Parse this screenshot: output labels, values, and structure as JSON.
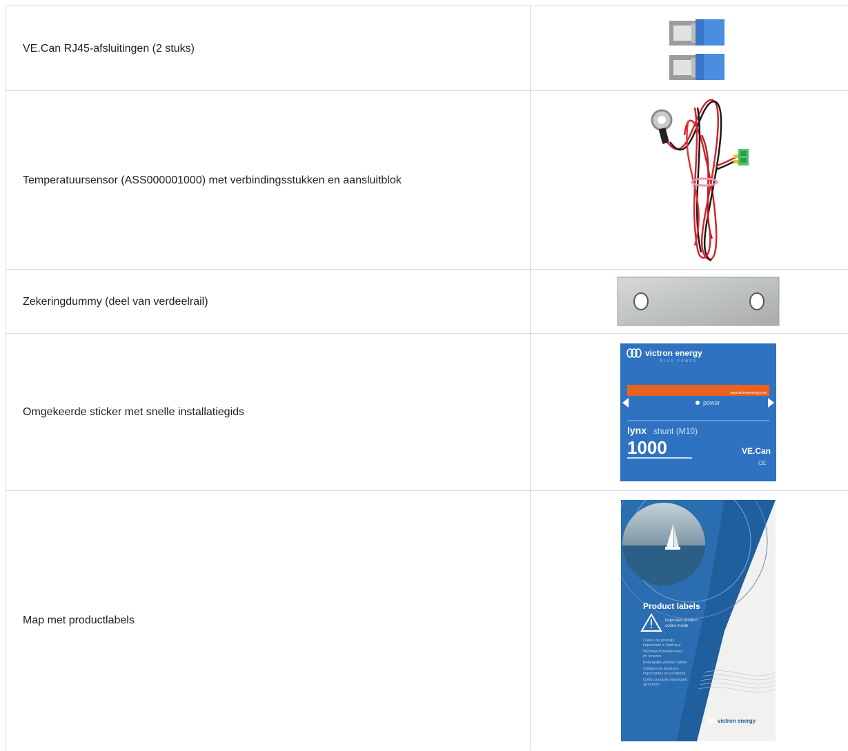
{
  "items": [
    {
      "description": "VE.Can RJ45-afsluitingen (2 stuks)",
      "image": "rj45-terminators-icon"
    },
    {
      "description": "Temperatuursensor (ASS000001000) met verbindingsstukken en aansluitblok",
      "image": "temperature-sensor-cable-icon"
    },
    {
      "description": "Zekeringdummy (deel van verdeelrail)",
      "image": "fuse-dummy-icon"
    },
    {
      "description": "Omgekeerde sticker met snelle installatiegids",
      "image": "sticker-icon"
    },
    {
      "description": "Map met productlabels",
      "image": "product-labels-folder-icon"
    }
  ],
  "sticker": {
    "brand": "victron energy",
    "tagline": "BLUE POWER",
    "url": "www.victronenergy.com",
    "power": "power",
    "product_bold": "lynx",
    "product_rest": "shunt  (M10)",
    "rating": "1000",
    "bus": "VE.Can",
    "mark": "CE"
  },
  "folder": {
    "heading": "Product labels",
    "lines": [
      "Important product",
      "codes inside",
      "Codes de produits",
      "importants à l'intérieur",
      "Wichtige Produktcodes",
      "im Inneren",
      "Belangrijke product labels",
      "Códigos de producto",
      "importantes en el interior",
      "Codici prodotto importanti",
      "all'interno"
    ],
    "brand": "victron energy"
  },
  "colors": {
    "victron_blue": "#2f72c1",
    "orange_strip": "#e9621f",
    "border": "#d9d9d9"
  }
}
